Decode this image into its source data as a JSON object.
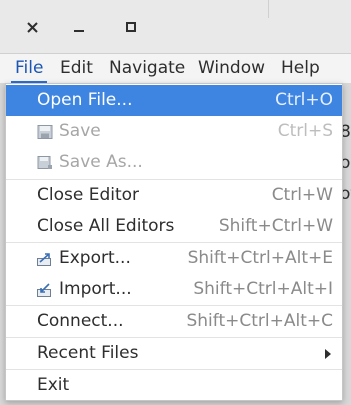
{
  "menubar": {
    "items": [
      "File",
      "Edit",
      "Navigate",
      "Window",
      "Help"
    ]
  },
  "file_menu": {
    "items": [
      {
        "label": "Open File...",
        "shortcut": "Ctrl+O",
        "icon": "",
        "state": "highlighted"
      },
      {
        "label": "Save",
        "shortcut": "Ctrl+S",
        "icon": "save-icon",
        "state": "disabled"
      },
      {
        "label": "Save As...",
        "shortcut": "",
        "icon": "save-as-icon",
        "state": "disabled"
      },
      {
        "label": "Close Editor",
        "shortcut": "Ctrl+W",
        "icon": "",
        "state": "enabled"
      },
      {
        "label": "Close All Editors",
        "shortcut": "Shift+Ctrl+W",
        "icon": "",
        "state": "enabled"
      },
      {
        "label": "Export...",
        "shortcut": "Shift+Ctrl+Alt+E",
        "icon": "export-icon",
        "state": "enabled"
      },
      {
        "label": "Import...",
        "shortcut": "Shift+Ctrl+Alt+I",
        "icon": "import-icon",
        "state": "enabled"
      },
      {
        "label": "Connect...",
        "shortcut": "Shift+Ctrl+Alt+C",
        "icon": "",
        "state": "enabled"
      },
      {
        "label": "Recent Files",
        "shortcut": "",
        "icon": "submenu-arrow-icon",
        "state": "enabled"
      },
      {
        "label": "Exit",
        "shortcut": "",
        "icon": "",
        "state": "enabled"
      }
    ]
  },
  "background": {
    "fragments": [
      "8",
      "ol",
      "ot"
    ]
  },
  "colors": {
    "highlight": "#3d85e0",
    "accent": "#2a6fd6",
    "disabled": "#a6a6a6"
  }
}
